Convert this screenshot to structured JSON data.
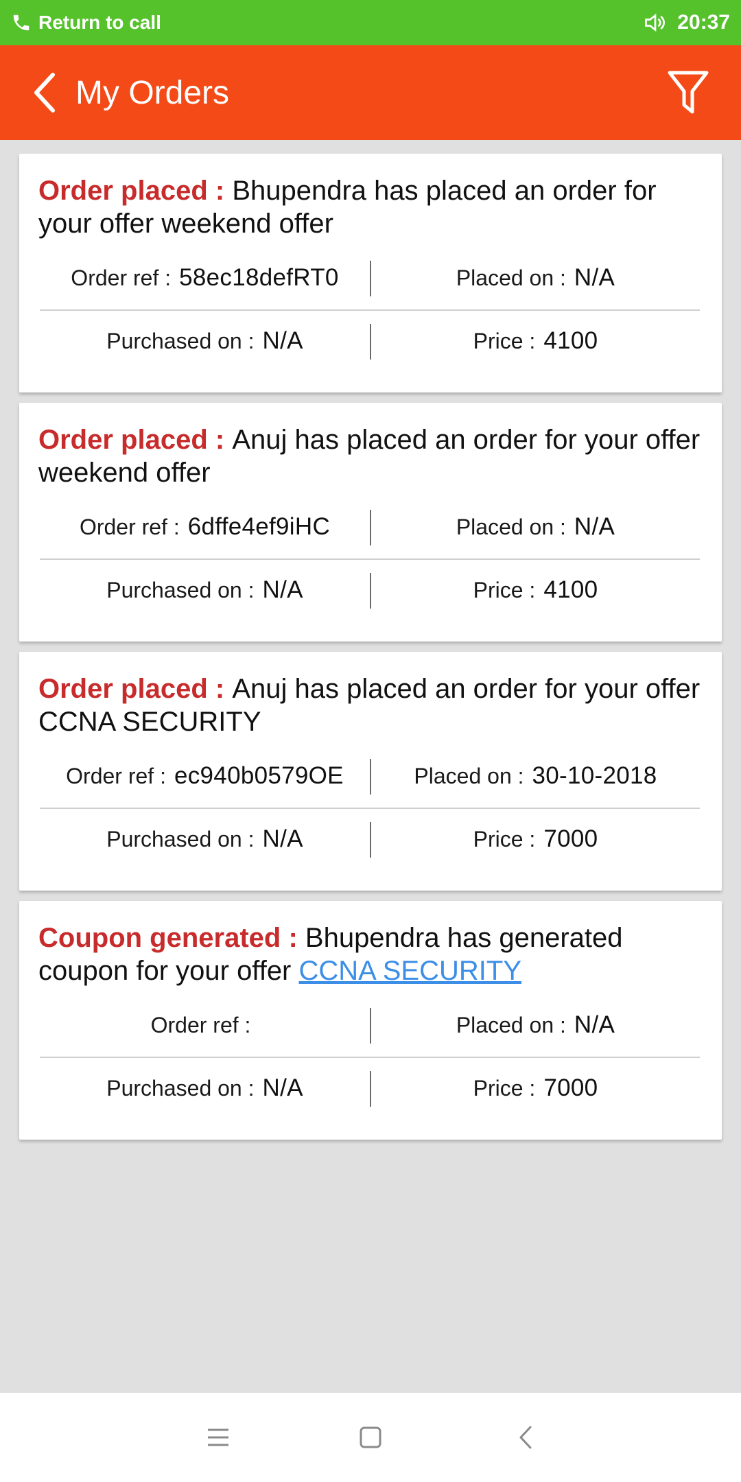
{
  "status_bar": {
    "return_to_call": "Return to call",
    "time": "20:37"
  },
  "app_bar": {
    "title": "My Orders"
  },
  "orders": [
    {
      "prefix": "Order placed : ",
      "message": "Bhupendra has placed an order for your offer weekend offer",
      "link": "",
      "order_ref_label": "Order ref :",
      "order_ref": "58ec18defRT0",
      "placed_on_label": "Placed on :",
      "placed_on": "N/A",
      "purchased_on_label": "Purchased on :",
      "purchased_on": "N/A",
      "price_label": "Price :",
      "price": "4100"
    },
    {
      "prefix": "Order placed : ",
      "message": "Anuj has placed an order for your offer weekend offer",
      "link": "",
      "order_ref_label": "Order ref :",
      "order_ref": "6dffe4ef9iHC",
      "placed_on_label": "Placed on :",
      "placed_on": "N/A",
      "purchased_on_label": "Purchased on :",
      "purchased_on": "N/A",
      "price_label": "Price :",
      "price": "4100"
    },
    {
      "prefix": "Order placed : ",
      "message": "Anuj has placed an order for your offer CCNA SECURITY",
      "link": "",
      "order_ref_label": "Order ref :",
      "order_ref": "ec940b0579OE",
      "placed_on_label": "Placed on :",
      "placed_on": "30-10-2018",
      "purchased_on_label": "Purchased on :",
      "purchased_on": "N/A",
      "price_label": "Price :",
      "price": "7000"
    },
    {
      "prefix": "Coupon generated : ",
      "message": "Bhupendra has generated coupon for your offer ",
      "link": "CCNA SECURITY",
      "order_ref_label": "Order ref :",
      "order_ref": "",
      "placed_on_label": "Placed on :",
      "placed_on": "N/A",
      "purchased_on_label": "Purchased on :",
      "purchased_on": "N/A",
      "price_label": "Price :",
      "price": "7000"
    }
  ],
  "colors": {
    "status_bar": "#55c22c",
    "app_bar": "#f44a17",
    "prefix": "#c82b2b",
    "link": "#3c8ee6",
    "background": "#e0e0e0"
  },
  "icons": {
    "status_left": "phone-icon",
    "status_right": "speaker-icon",
    "back": "chevron-left-icon",
    "filter": "filter-icon",
    "nav": [
      "menu-icon",
      "home-square-icon",
      "back-chevron-icon"
    ]
  }
}
